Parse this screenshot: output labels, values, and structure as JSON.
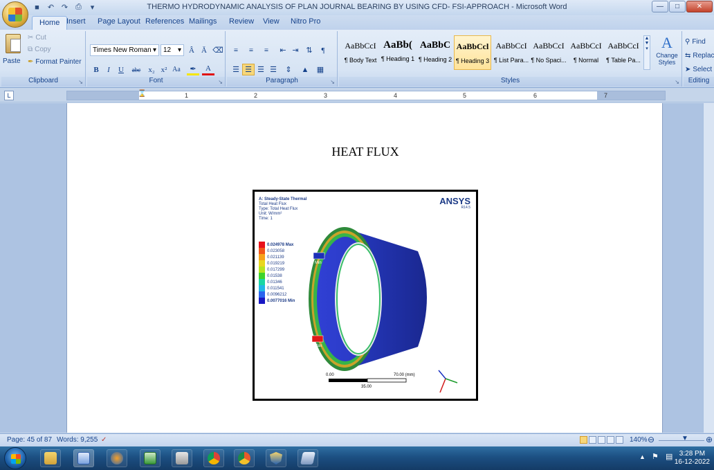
{
  "window": {
    "title": "THERMO HYDRODYNAMIC ANALYSIS OF PLAN JOURNAL BEARING BY USING CFD- FSI-APPROACH - Microsoft Word"
  },
  "tabs": [
    "Home",
    "Insert",
    "Page Layout",
    "References",
    "Mailings",
    "Review",
    "View",
    "Nitro Pro"
  ],
  "clipboard": {
    "paste": "Paste",
    "cut": "Cut",
    "copy": "Copy",
    "format_painter": "Format Painter",
    "label": "Clipboard"
  },
  "font": {
    "family": "Times New Roman",
    "size": "12",
    "label": "Font"
  },
  "paragraph": {
    "label": "Paragraph"
  },
  "styles": {
    "label": "Styles",
    "items": [
      {
        "sample": "AaBbCcI",
        "name": "¶ Body Text"
      },
      {
        "sample": "AaBb(",
        "name": "¶ Heading 1"
      },
      {
        "sample": "AaBbC",
        "name": "¶ Heading 2"
      },
      {
        "sample": "AaBbCcl",
        "name": "¶ Heading 3"
      },
      {
        "sample": "AaBbCcI",
        "name": "¶ List Para..."
      },
      {
        "sample": "AaBbCcI",
        "name": "¶ No Spaci..."
      },
      {
        "sample": "AaBbCcI",
        "name": "¶ Normal"
      },
      {
        "sample": "AaBbCcI",
        "name": "¶ Table Pa..."
      }
    ],
    "change_styles": "Change Styles"
  },
  "editing": {
    "label": "Editing",
    "find": "Find",
    "replace": "Replace",
    "select": "Select"
  },
  "ruler_numbers": [
    "1",
    "2",
    "3",
    "4",
    "5",
    "6",
    "7"
  ],
  "document": {
    "heading": "HEAT FLUX",
    "figure": {
      "header": {
        "line1": "A: Steady-State Thermal",
        "line2": "Total Heat Flux",
        "line3": "Type: Total Heat Flux",
        "line4": "Unit: W/mm²",
        "line5": "Time: 1"
      },
      "brand": "ANSYS",
      "version": "R14.5",
      "legend": [
        {
          "value": "0.024978 Max",
          "color": "#e8101a",
          "bold": true
        },
        {
          "value": "0.023058",
          "color": "#f2561a"
        },
        {
          "value": "0.021139",
          "color": "#f7a21c"
        },
        {
          "value": "0.019219",
          "color": "#e9d71f"
        },
        {
          "value": "0.017299",
          "color": "#b7e41f"
        },
        {
          "value": "0.01538",
          "color": "#3ed42b"
        },
        {
          "value": "0.01346",
          "color": "#19d6a4"
        },
        {
          "value": "0.011541",
          "color": "#20b7e6"
        },
        {
          "value": "0.0096212",
          "color": "#2a64ee"
        },
        {
          "value": "0.0077016 Min",
          "color": "#1818c4",
          "bold": true
        }
      ],
      "min_tag": "Min",
      "max_tag": "Max",
      "scale_start": "0.00",
      "scale_end": "70.00 (mm)",
      "scale_mid": "35.00"
    }
  },
  "status": {
    "page": "Page: 45 of 87",
    "words": "Words: 9,255",
    "zoom": "140%"
  },
  "clock": {
    "time": "3:28 PM",
    "date": "16-12-2022"
  }
}
